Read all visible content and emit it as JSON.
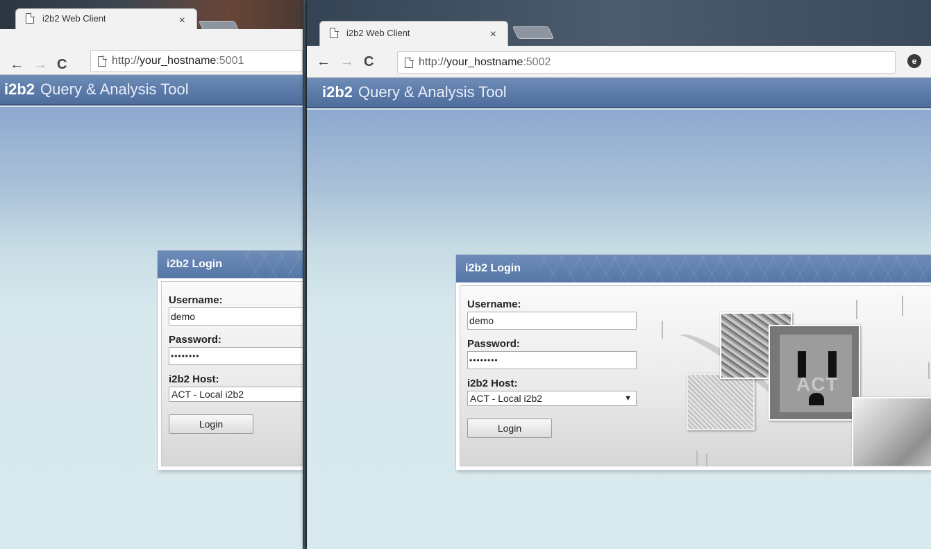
{
  "left_window": {
    "tab_title": "i2b2 Web Client",
    "tab_close": "×",
    "url_scheme": "http://",
    "url_host": "your_hostname",
    "url_port": ":5001",
    "app_logo": "i2b2",
    "app_title": "Query & Analysis Tool",
    "login": {
      "title": "i2b2 Login",
      "username_label": "Username:",
      "username_value": "demo",
      "password_label": "Password:",
      "password_value": "••••••••",
      "host_label": "i2b2 Host:",
      "host_value": "ACT - Local i2b2",
      "login_button": "Login"
    }
  },
  "right_window": {
    "tab_title": "i2b2 Web Client",
    "tab_close": "×",
    "url_scheme": "http://",
    "url_host": "your_hostname",
    "url_port": ":5002",
    "extension_icon": "e",
    "app_logo": "i2b2",
    "app_title": "Query & Analysis Tool",
    "login": {
      "title": "i2b2 Login",
      "username_label": "Username:",
      "username_value": "demo",
      "password_label": "Password:",
      "password_value": "••••••••",
      "host_label": "i2b2 Host:",
      "host_value": "ACT - Local i2b2",
      "host_caret": "▼",
      "login_button": "Login",
      "artwork_text": "ACT"
    }
  },
  "icons": [
    "page-icon",
    "back-arrow-icon",
    "forward-arrow-icon",
    "reload-icon",
    "close-icon",
    "extension-icon",
    "dropdown-caret-icon"
  ],
  "colors": {
    "app_bar": "#5b7aa8",
    "login_header": "#6e8cb8",
    "content_bg": "#d9eaee"
  }
}
